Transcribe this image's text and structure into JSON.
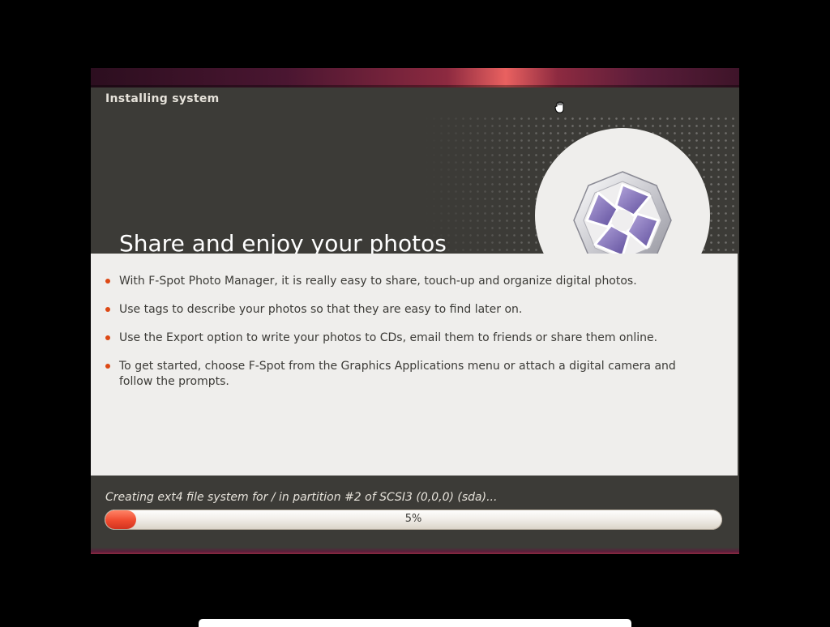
{
  "window": {
    "title": "Installing system"
  },
  "slide": {
    "headline": "Share and enjoy your photos",
    "logo_icon": "f-spot-icon",
    "bullets": [
      "With F-Spot Photo Manager, it is really easy to share, touch-up and organize digital photos.",
      "Use tags to describe your photos so that they are easy to find later on.",
      "Use the Export option to write your photos to CDs, email them to friends or share them online.",
      "To get started, choose F-Spot from the Graphics Applications menu or attach a digital camera and follow the prompts."
    ]
  },
  "status": {
    "text": "Creating ext4 file system for / in partition #2 of SCSI3 (0,0,0) (sda)...",
    "progress_value": 0.05,
    "progress_label": "5%"
  },
  "colors": {
    "accent": "#dd4814",
    "progress_fill": "#ef4a2f",
    "dark_panel": "#3c3b37",
    "light_panel": "#efeeec"
  }
}
